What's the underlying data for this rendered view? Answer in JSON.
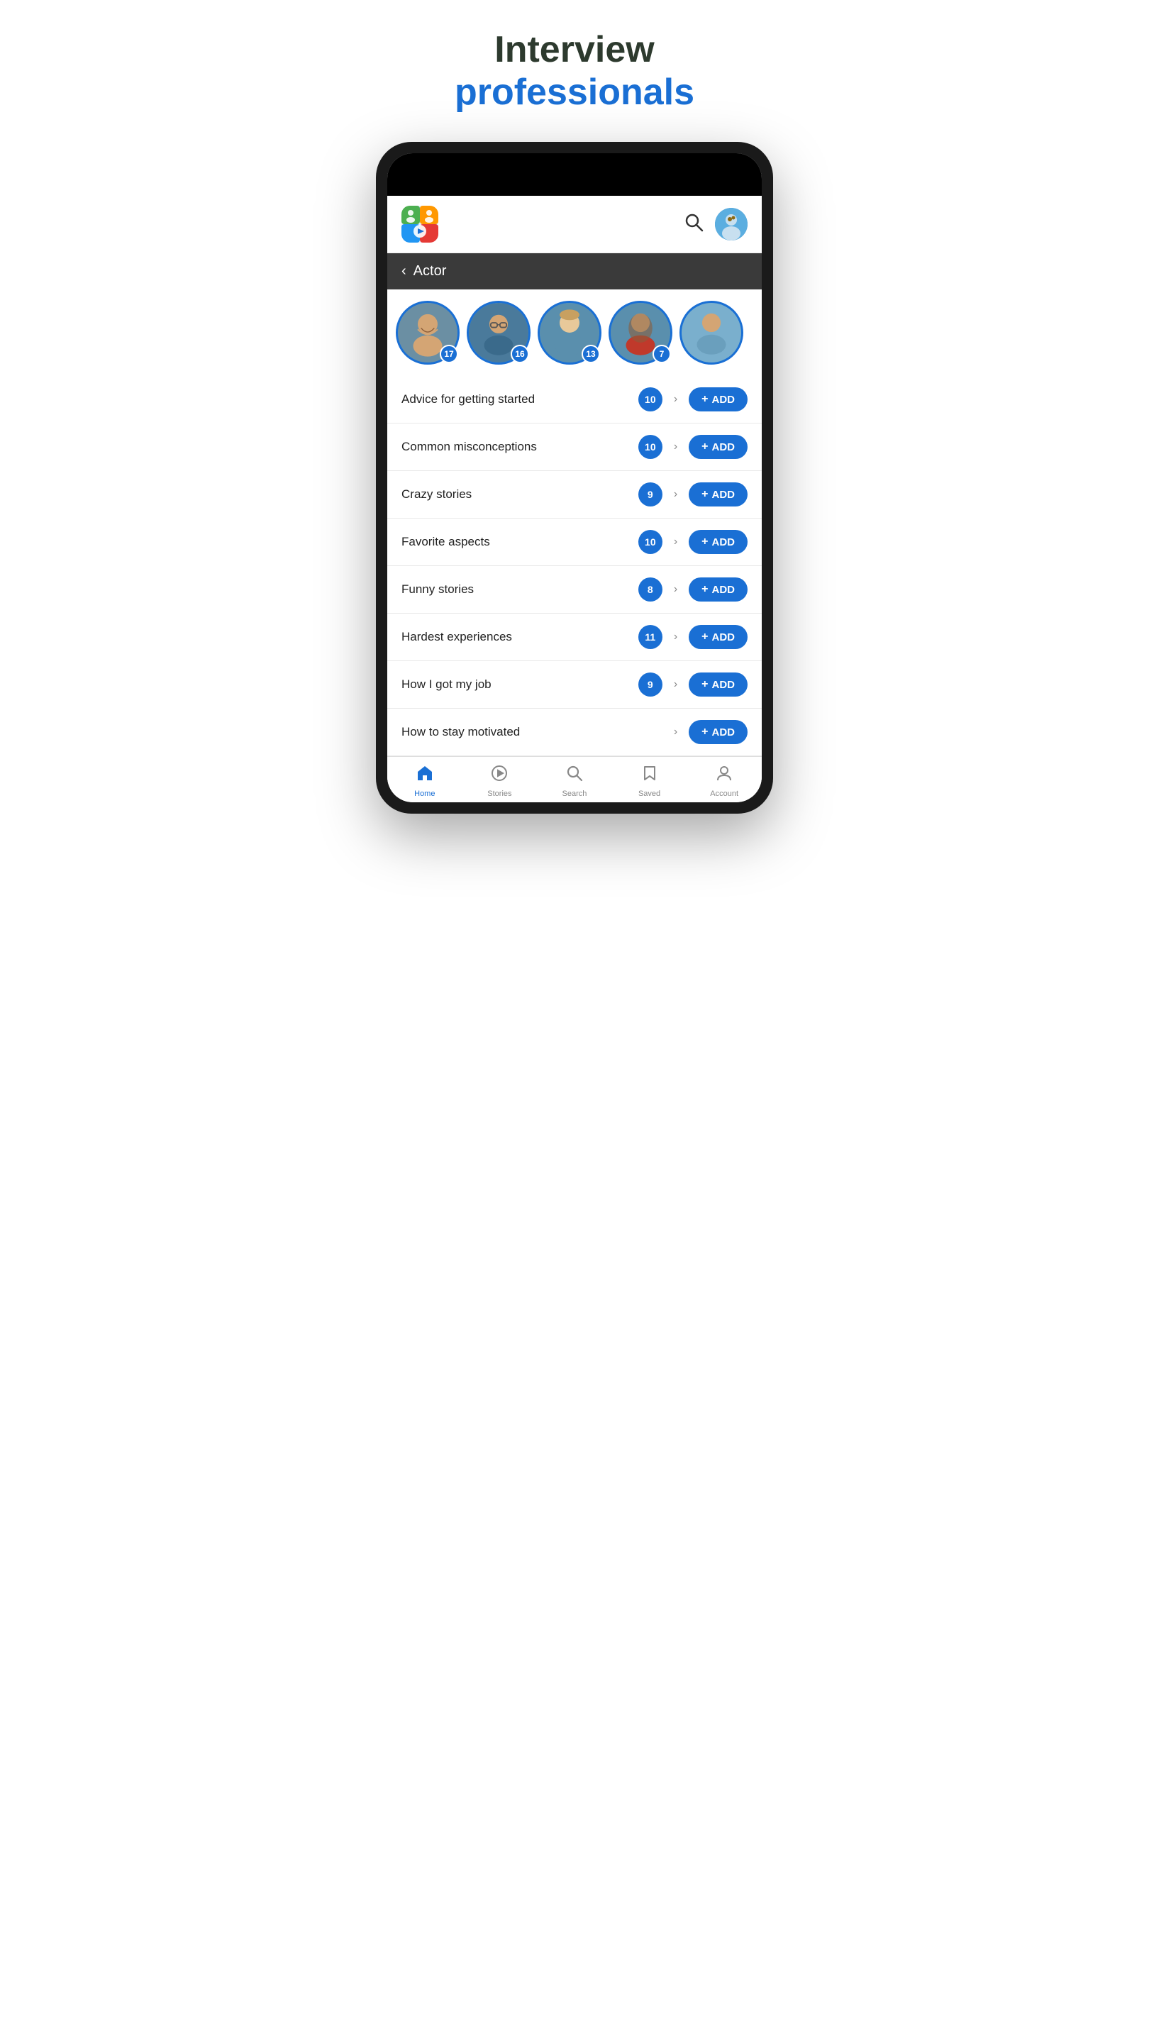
{
  "page": {
    "title_line1": "Interview",
    "title_line2": "professionals"
  },
  "header": {
    "search_label": "Search",
    "avatar_alt": "User avatar"
  },
  "back_nav": {
    "label": "Actor"
  },
  "profiles": [
    {
      "badge": "17"
    },
    {
      "badge": "16"
    },
    {
      "badge": "13"
    },
    {
      "badge": "7"
    },
    {
      "badge": ""
    }
  ],
  "topics": [
    {
      "label": "Advice for getting started",
      "count": "10",
      "has_count": true
    },
    {
      "label": "Common misconceptions",
      "count": "10",
      "has_count": true
    },
    {
      "label": "Crazy stories",
      "count": "9",
      "has_count": true
    },
    {
      "label": "Favorite aspects",
      "count": "10",
      "has_count": true
    },
    {
      "label": "Funny stories",
      "count": "8",
      "has_count": true
    },
    {
      "label": "Hardest experiences",
      "count": "11",
      "has_count": true
    },
    {
      "label": "How I got my job",
      "count": "9",
      "has_count": true
    },
    {
      "label": "How to stay motivated",
      "count": "",
      "has_count": false
    },
    {
      "label": "...",
      "count": "",
      "has_count": true
    }
  ],
  "add_button_label": "+ ADD",
  "bottom_nav": [
    {
      "id": "home",
      "label": "Home",
      "icon": "🏠",
      "active": true
    },
    {
      "id": "stories",
      "label": "Stories",
      "icon": "▶",
      "active": false
    },
    {
      "id": "search",
      "label": "Search",
      "icon": "🔍",
      "active": false
    },
    {
      "id": "saved",
      "label": "Saved",
      "icon": "🔖",
      "active": false
    },
    {
      "id": "account",
      "label": "Account",
      "icon": "👤",
      "active": false
    }
  ]
}
